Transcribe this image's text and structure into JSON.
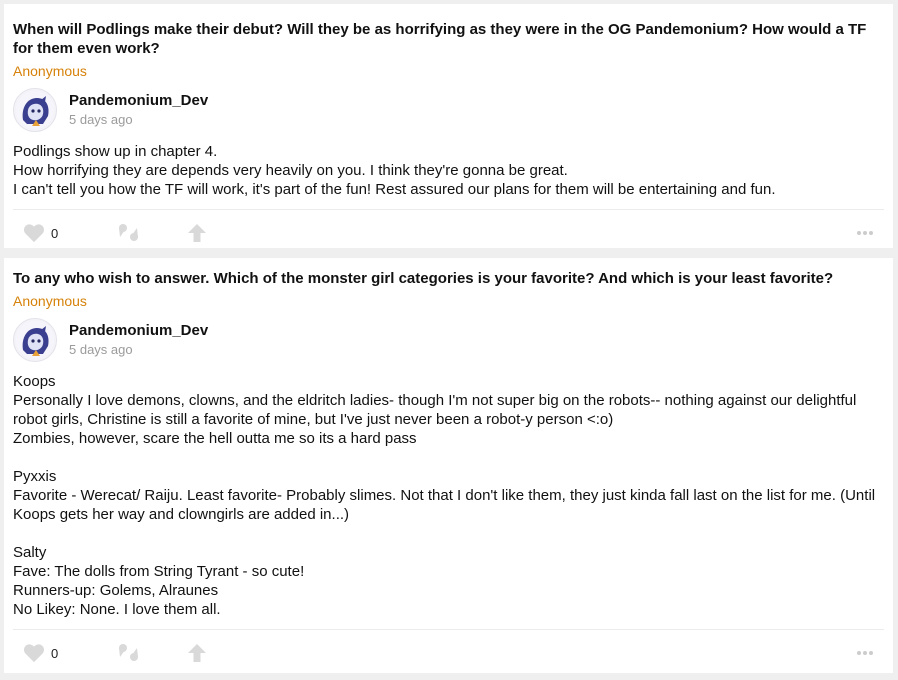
{
  "posts": [
    {
      "question": "When will Podlings make their debut? Will they be as horrifying as they were in the OG Pandemonium? How would a TF for them even work?",
      "asker": "Anonymous",
      "author": "Pandemonium_Dev",
      "time": "5 days ago",
      "body": "Podlings show up in chapter 4.\nHow horrifying they are depends very heavily on you. I think they're gonna be great.\nI can't tell you how the TF will work, it's part of the fun! Rest assured our plans for them will be entertaining and fun.",
      "likes": "0"
    },
    {
      "question": "To any who wish to answer. Which of the monster girl categories is your favorite? And which is your least favorite?",
      "asker": "Anonymous",
      "author": "Pandemonium_Dev",
      "time": "5 days ago",
      "body": "Koops\nPersonally I love  demons, clowns, and the eldritch ladies- though I'm not super big on the robots-- nothing against our delightful robot girls, Christine is still a favorite of mine, but I've just never been a robot-y person <:o)\nZombies, however, scare the hell outta me so its a hard pass\n\nPyxxis\nFavorite - Werecat/ Raiju. Least  favorite- Probably slimes. Not that  I don't like them, they just kinda fall last on the list for me. (Until Koops gets her  way and clowngirls are added  in...)\n\nSalty\nFave: The dolls from String Tyrant - so cute!\nRunners-up: Golems, Alraunes\nNo Likey: None. I love them all.",
      "likes": "0"
    }
  ],
  "icons": {
    "like": "heart-icon",
    "quote": "quote-icon",
    "share": "share-arrow-icon",
    "more": "ellipsis-icon",
    "avatar": "avatar-icon"
  },
  "colors": {
    "asker": "#d6820a",
    "icon": "#d9d9d9",
    "background": "#efefef"
  }
}
